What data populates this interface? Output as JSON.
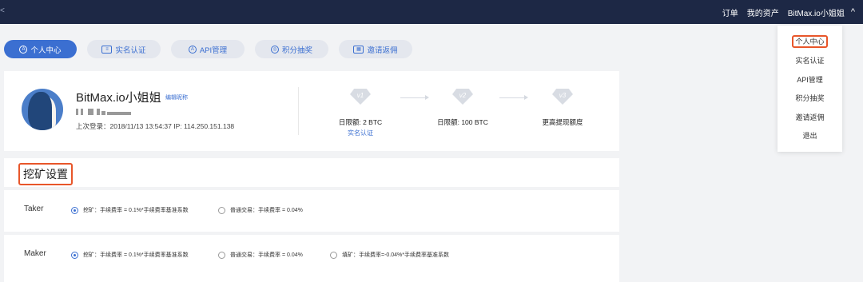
{
  "topbar": {
    "back": "<",
    "orders": "订单",
    "my_assets": "我的资产",
    "username": "BitMax.io小姐姐",
    "chevron": "^"
  },
  "tabs": [
    {
      "label": "个人中心",
      "icon": "user-circle-icon",
      "active": true
    },
    {
      "label": "实名认证",
      "icon": "id-card-icon",
      "active": false
    },
    {
      "label": "API管理",
      "icon": "api-icon",
      "active": false
    },
    {
      "label": "积分抽奖",
      "icon": "target-icon",
      "active": false
    },
    {
      "label": "邀请返佣",
      "icon": "gift-icon",
      "active": false
    }
  ],
  "tab_icons": [
    "A",
    "≡",
    "A",
    "◎",
    "▦"
  ],
  "profile": {
    "name": "BitMax.io小姐姐",
    "edit_nickname": "编辑昵称",
    "last_login": "上次登录：2018/11/13 13:54:37  IP: 114.250.151.138",
    "levels": [
      {
        "badge": "v1",
        "limit": "日限额: 2 BTC",
        "action": "实名认证"
      },
      {
        "badge": "v2",
        "limit": "日限额: 100 BTC",
        "action": ""
      },
      {
        "badge": "v3",
        "limit": "更高提现额度",
        "action": ""
      }
    ]
  },
  "mining": {
    "title": "挖矿设置",
    "rows": [
      {
        "label": "Taker",
        "options": [
          {
            "text": "挖矿：手续费率 = 0.1%*手续费率基准系数",
            "selected": true
          },
          {
            "text": "普通交易：手续费率 = 0.04%",
            "selected": false
          }
        ]
      },
      {
        "label": "Maker",
        "options": [
          {
            "text": "挖矿：手续费率 = 0.1%*手续费率基准系数",
            "selected": true
          },
          {
            "text": "普通交易：手续费率 = 0.04%",
            "selected": false
          },
          {
            "text": "填矿：手续费率=-0.04%*手续费率基准系数",
            "selected": false
          }
        ]
      }
    ]
  },
  "dropdown": {
    "items": [
      "个人中心",
      "实名认证",
      "API管理",
      "积分抽奖",
      "邀请返佣",
      "退出"
    ]
  },
  "colors": {
    "topbar": "#1d2845",
    "accent": "#3b6fd1",
    "highlight_border": "#e8562a"
  }
}
